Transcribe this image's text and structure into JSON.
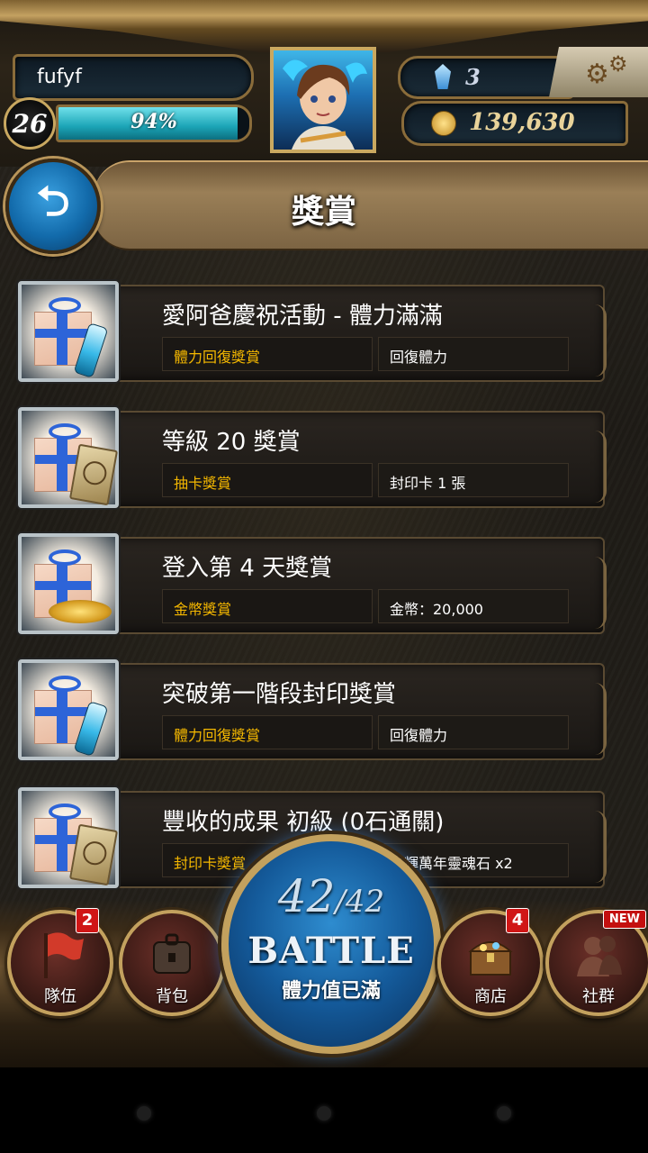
{
  "player": {
    "name": "fufyf",
    "level": "26",
    "exp_percent_label": "94%",
    "exp_fraction": 0.94,
    "gems": "3",
    "coins": "139,630"
  },
  "header": {
    "title": "獎賞",
    "back_icon": "back-arrow-icon",
    "settings_icon": "gear-icon"
  },
  "rewards": [
    {
      "title": "愛阿爸慶祝活動 - 體力滿滿",
      "tag": "體力回復獎賞",
      "desc": "回復體力",
      "icon": "gift-stamina-vial-icon"
    },
    {
      "title": "等級 20 獎賞",
      "tag": "抽卡獎賞",
      "desc": "封印卡 1 張",
      "icon": "gift-seal-card-icon"
    },
    {
      "title": "登入第 4 天獎賞",
      "tag": "金幣獎賞",
      "desc": "金幣：20,000",
      "icon": "gift-gold-coins-icon"
    },
    {
      "title": "突破第一階段封印獎賞",
      "tag": "體力回復獎賞",
      "desc": "回復體力",
      "icon": "gift-stamina-vial-icon"
    },
    {
      "title": "豐收的成果 初級 (0石通關)",
      "tag": "封印卡獎賞",
      "desc": "光輝萬年靈魂石 x2",
      "icon": "gift-seal-card-icon"
    }
  ],
  "nav": {
    "team": {
      "label": "隊伍",
      "badge": "2",
      "icon": "red-flag-icon"
    },
    "bag": {
      "label": "背包",
      "icon": "backpack-icon"
    },
    "battle": {
      "count": "42",
      "max": "/42",
      "word": "BATTLE",
      "status": "體力值已滿"
    },
    "shop": {
      "label": "商店",
      "badge": "4",
      "icon": "treasure-chest-icon"
    },
    "social": {
      "label": "社群",
      "badge": "NEW",
      "icon": "people-icon"
    }
  },
  "colors": {
    "tag_text": "#f5b800",
    "exp_bar": "#1ba4b6",
    "badge_red": "#d01616"
  }
}
